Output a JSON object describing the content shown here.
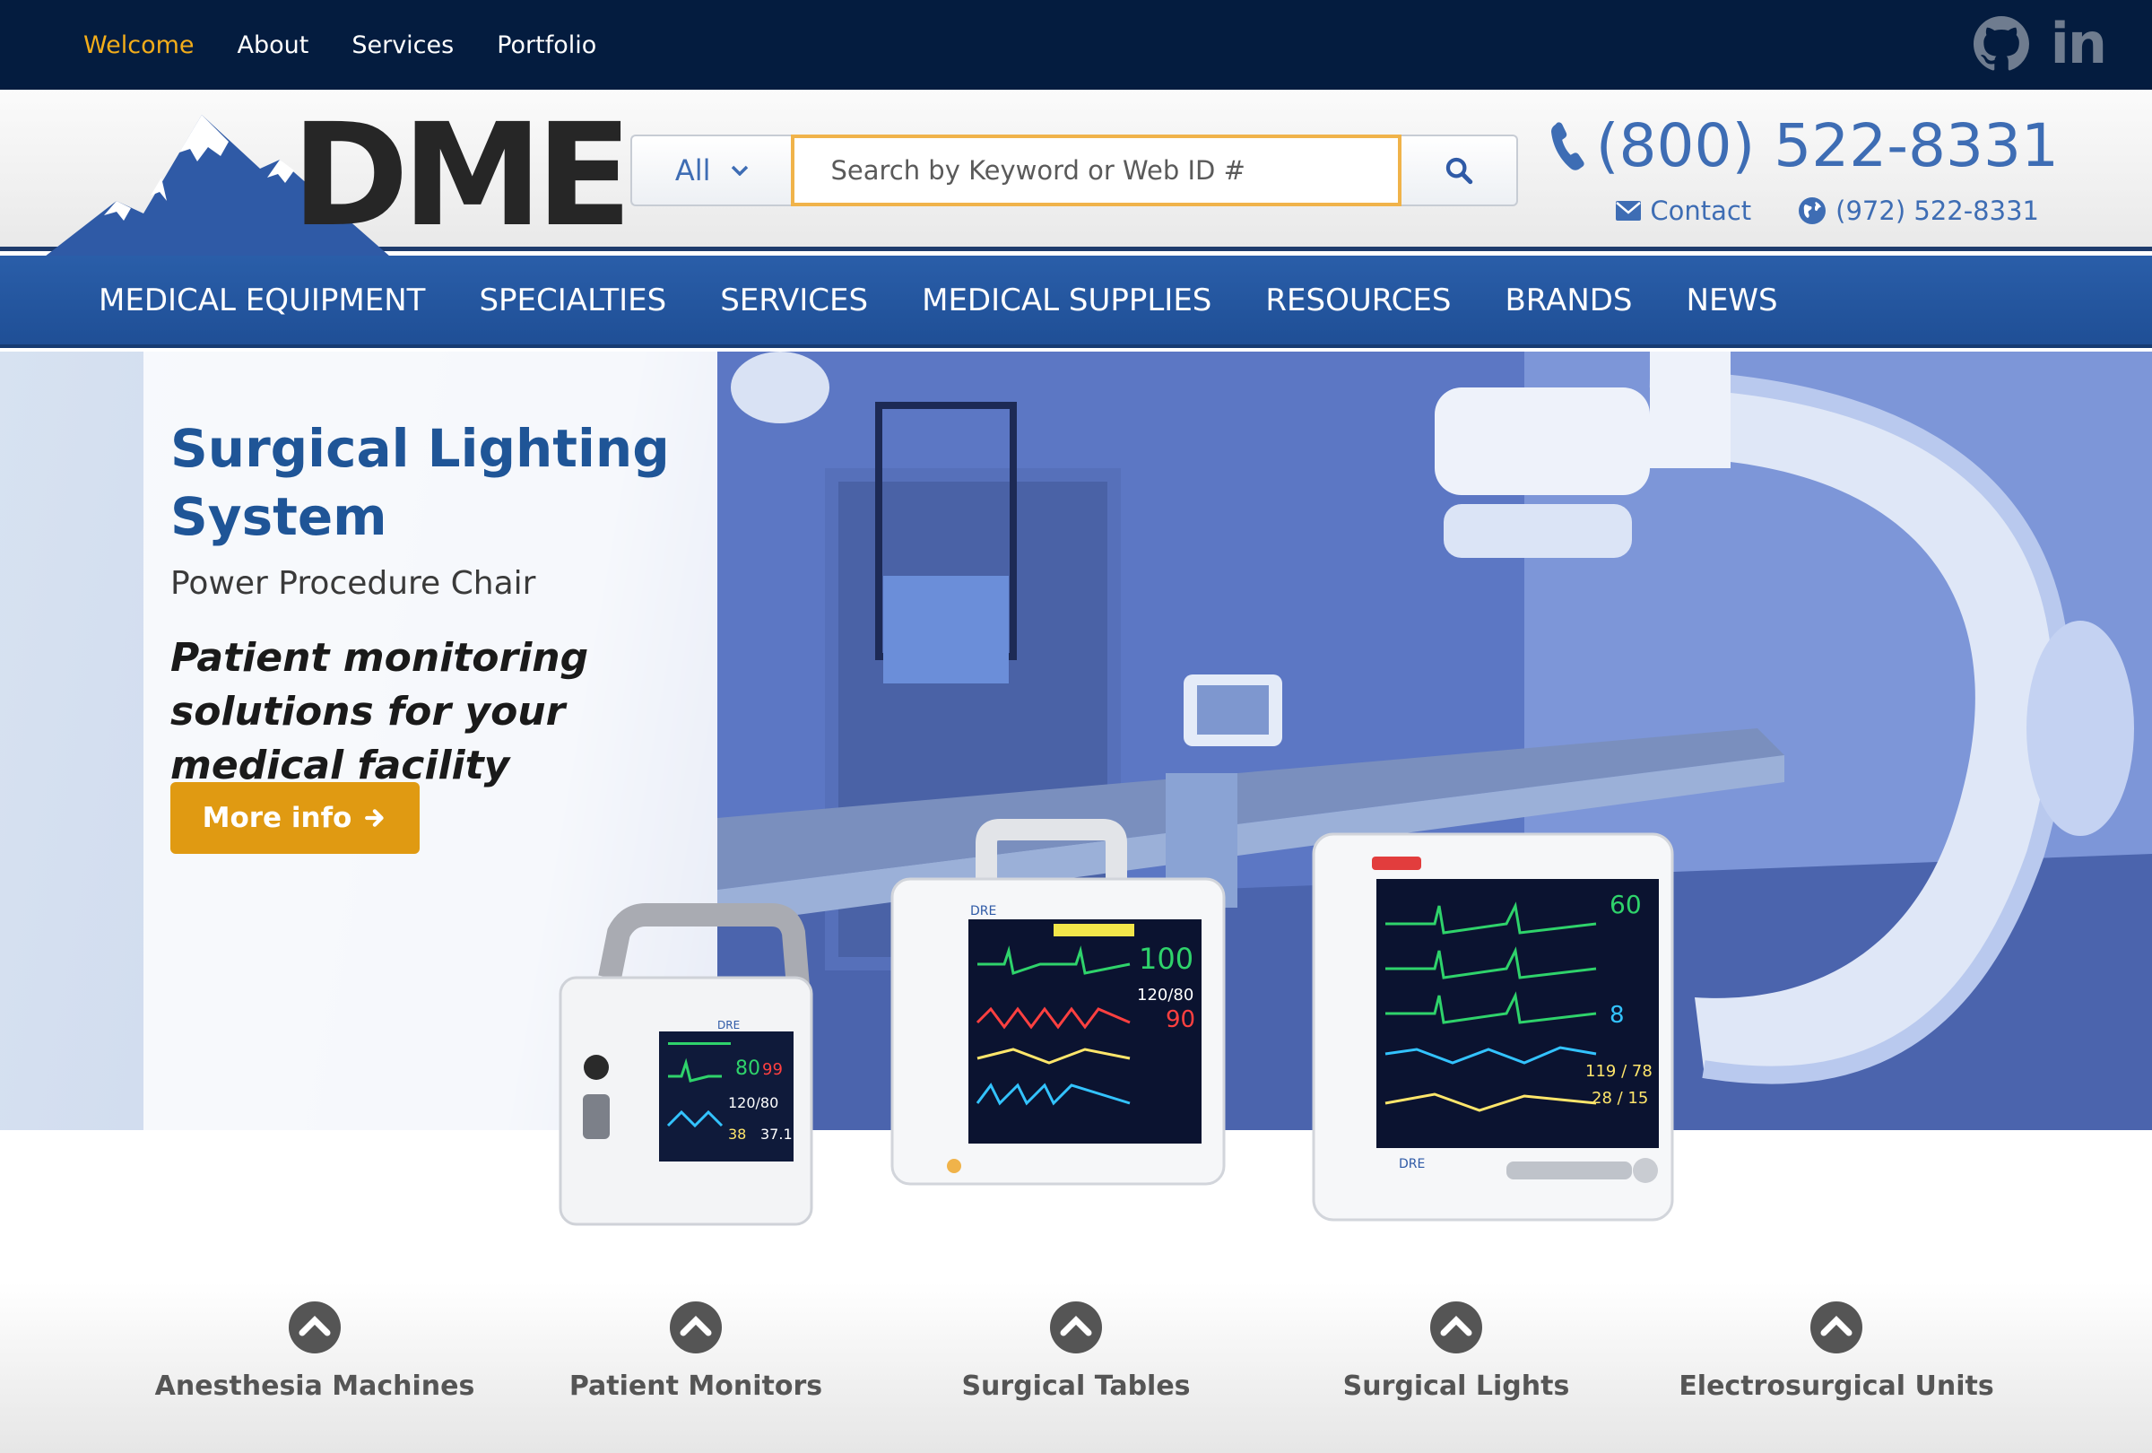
{
  "top_nav": {
    "items": [
      {
        "label": "Welcome",
        "active": true
      },
      {
        "label": "About"
      },
      {
        "label": "Services"
      },
      {
        "label": "Portfolio"
      }
    ],
    "social": {
      "github_icon": "github-icon",
      "linkedin_label": "in"
    }
  },
  "header": {
    "logo_text": "DME",
    "search": {
      "category": "All",
      "placeholder": "Search by Keyword or Web ID #",
      "button_icon": "search-icon"
    },
    "phone": "(800) 522-8331",
    "contact_label": "Contact",
    "alt_phone": "(972) 522-8331",
    "accent_color": "#3e6db4"
  },
  "main_nav": {
    "items": [
      "MEDICAL EQUIPMENT",
      "SPECIALTIES",
      "SERVICES",
      "MEDICAL SUPPLIES",
      "RESOURCES",
      "BRANDS",
      "NEWS"
    ]
  },
  "hero": {
    "title": "Surgical Lighting System",
    "subtitle": "Power Procedure Chair",
    "tagline": "Patient monitoring solutions for your medical facility",
    "button_label": "More info",
    "button_color": "#e09a12"
  },
  "monitors": {
    "small": {
      "brand": "DRE",
      "vals": [
        "80",
        "99",
        "120/80",
        "38",
        "37.1"
      ]
    },
    "medium": {
      "brand": "DRE",
      "vals": [
        "100",
        "120/80",
        "90"
      ]
    },
    "large": {
      "brand": "DRE",
      "vals": [
        "60",
        "8",
        "119 / 78",
        "28 / 15"
      ]
    }
  },
  "categories": [
    {
      "label": "Anesthesia Machines"
    },
    {
      "label": "Patient Monitors"
    },
    {
      "label": "Surgical Tables"
    },
    {
      "label": "Surgical Lights"
    },
    {
      "label": "Electrosurgical Units"
    }
  ]
}
